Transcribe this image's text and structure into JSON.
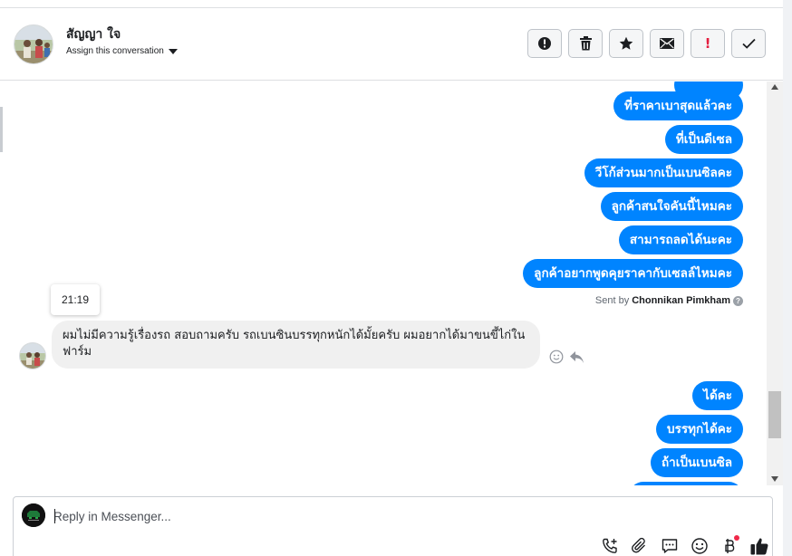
{
  "header": {
    "contact_name": "สัญญา ใจ",
    "assign_label": "Assign this conversation",
    "actions": [
      {
        "name": "spam-button",
        "icon": "alert-circle-icon"
      },
      {
        "name": "delete-button",
        "icon": "trash-icon"
      },
      {
        "name": "star-button",
        "icon": "star-icon"
      },
      {
        "name": "mark-unread-button",
        "icon": "envelope-icon"
      },
      {
        "name": "follow-up-button",
        "icon": "exclamation-icon",
        "label": "!"
      },
      {
        "name": "mark-done-button",
        "icon": "checkmark-icon"
      }
    ]
  },
  "thread": {
    "outgoing_top": [
      "ที่ราคาเบาสุดแล้วคะ",
      "ที่เป็นดีเซล",
      "วีโก้ส่วนมากเป็นเบนซิลคะ",
      "ลูกค้าสนใจคันนี้ไหมคะ",
      "สามารถลดได้นะคะ",
      "ลูกค้าอยากพูดคุยราคากับเซลล์ไหมคะ"
    ],
    "sent_by_prefix": "Sent by",
    "sent_by_name": "Chonnikan Pimkham",
    "time_label": "21:19",
    "incoming_message": "ผมไม่มีความรู้เรื่องรถ สอบถามครับ รถเบนซินบรรทุกหนักได้มั้ยครับ ผมอยากได้มาขนขี้ไก่ในฟาร์ม",
    "outgoing_bottom": [
      "ได้คะ",
      "บรรทุกได้คะ",
      "ถ้าเป็นเบนซิล"
    ]
  },
  "composer": {
    "placeholder": "Reply in Messenger...",
    "tools": [
      "phone-plus-icon",
      "paperclip-icon",
      "chat-bubble-icon",
      "smiley-icon",
      "baht-icon",
      "thumbs-up-icon"
    ]
  },
  "colors": {
    "accent": "#0084ff",
    "incoming_bubble": "#f0f0f0",
    "notification_dot": "#f02849"
  }
}
